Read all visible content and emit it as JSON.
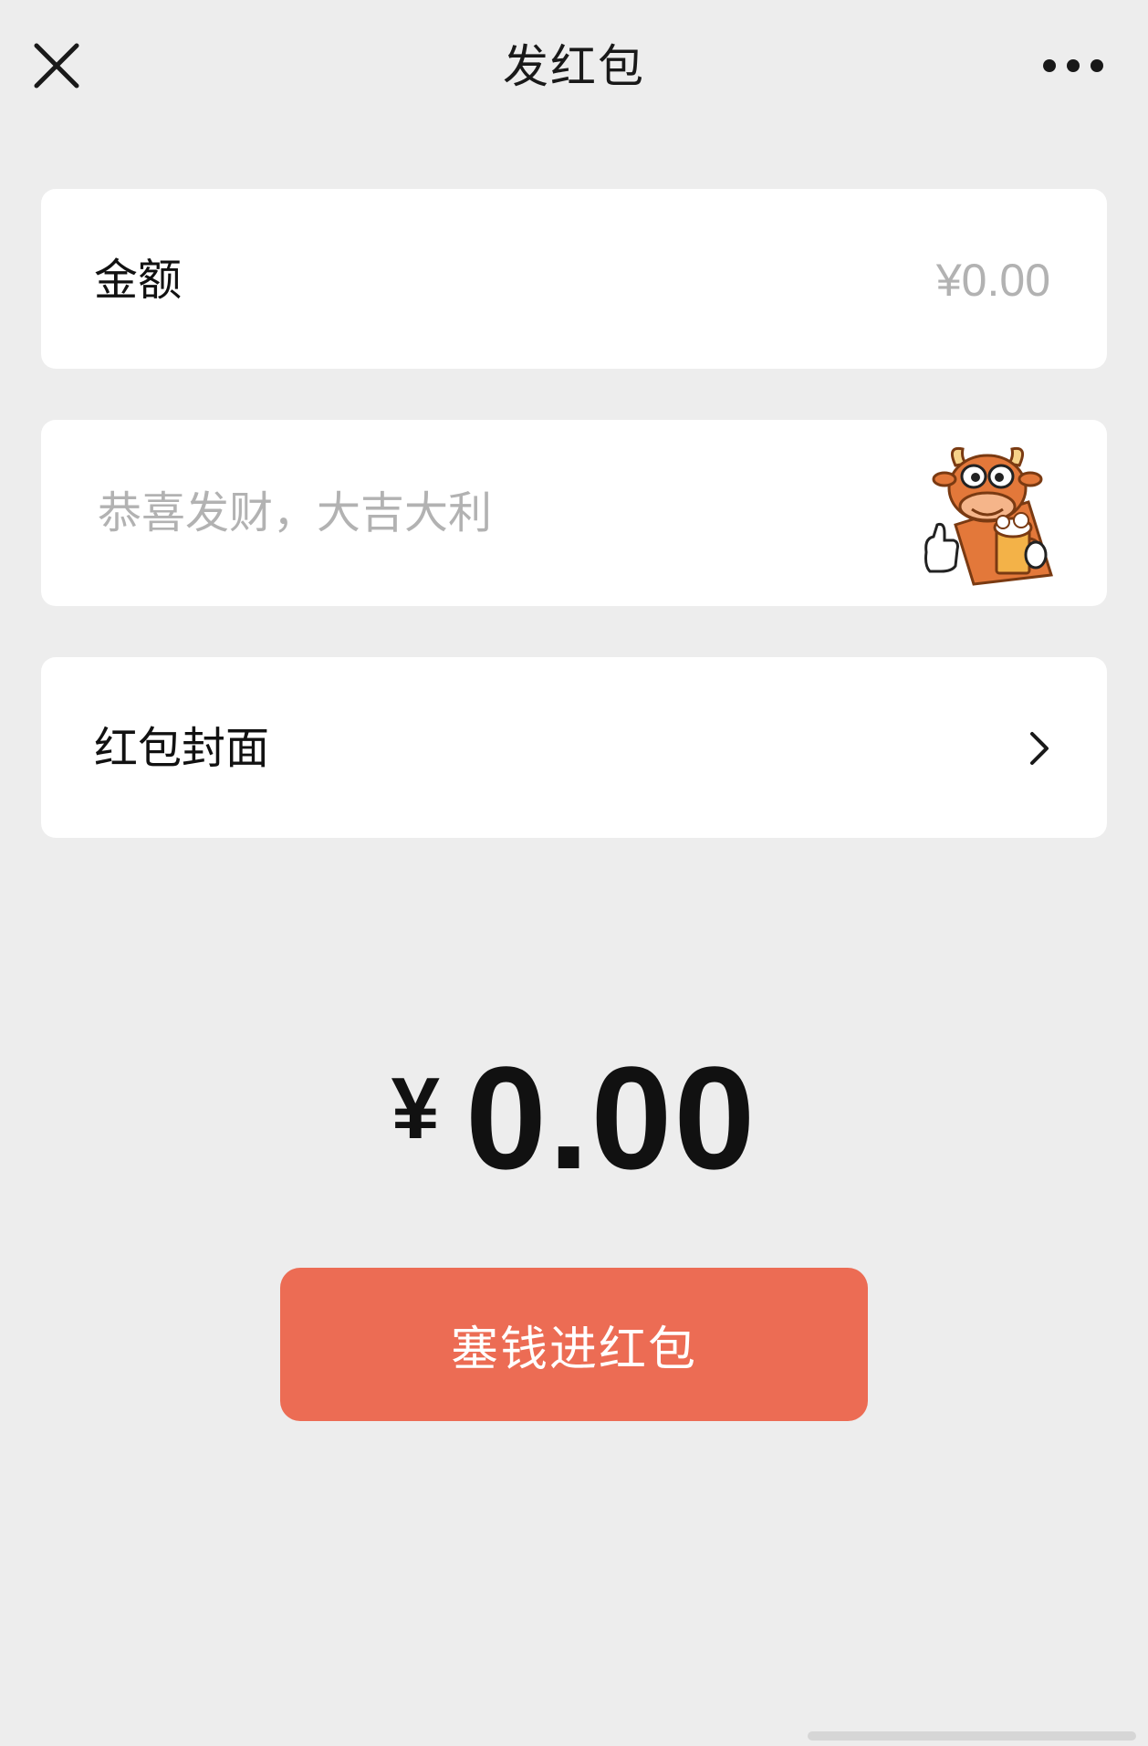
{
  "header": {
    "title": "发红包"
  },
  "amount_row": {
    "label": "金额",
    "placeholder": "¥0.00"
  },
  "greeting_row": {
    "placeholder": "恭喜发财，大吉大利",
    "sticker_icon": "cow-beer-thumbs-up-sticker"
  },
  "cover_row": {
    "label": "红包封面"
  },
  "total": {
    "currency": "¥",
    "amount": "0.00"
  },
  "submit": {
    "label": "塞钱进红包"
  },
  "colors": {
    "background": "#ededed",
    "card": "#ffffff",
    "primary_button": "#ec6c54",
    "placeholder": "#b2b2b2",
    "text": "#111111"
  }
}
